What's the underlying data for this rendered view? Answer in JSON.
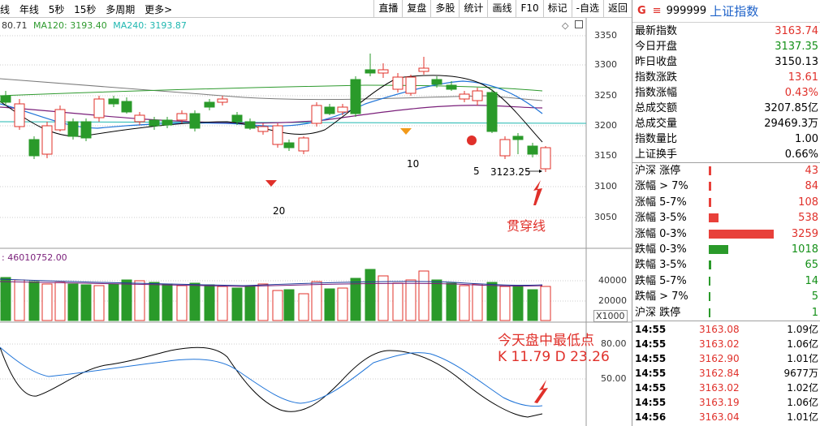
{
  "toolbar": {
    "left_items": [
      "线",
      "年线",
      "5秒",
      "15秒",
      "多周期",
      "更多>"
    ],
    "right_items": [
      "直播",
      "复盘",
      "多股",
      "统计",
      "画线",
      "F10",
      "标记",
      "-自选",
      "返回"
    ]
  },
  "main_chart": {
    "ma_line": {
      "ma_prefix": "80.71",
      "ma120": "MA120: 3193.40",
      "ma240": "MA240: 3193.87"
    },
    "y_ticks": [
      "3350",
      "3300",
      "3250",
      "3200",
      "3150",
      "3100",
      "3050"
    ],
    "marker_labels": [
      "20",
      "10",
      "5"
    ],
    "low_price_label": "3123.25",
    "annotation": "贯穿线"
  },
  "volume_chart": {
    "header": ": 46010752.00",
    "y_ticks": [
      "40000",
      "20000"
    ],
    "unit": "X1000"
  },
  "kdj_chart": {
    "y_ticks": [
      "80.00",
      "50.00"
    ],
    "annotation_line1": "今天盘中最低点",
    "annotation_line2": "K 11.79  D 23.26"
  },
  "right_panel": {
    "g_label": "G",
    "menu_icon": "≡",
    "code": "999999",
    "name": "上证指数",
    "quote": [
      {
        "label": "最新指数",
        "value": "3163.74",
        "color": "red"
      },
      {
        "label": "今日开盘",
        "value": "3137.35",
        "color": "green"
      },
      {
        "label": "昨日收盘",
        "value": "3150.13",
        "color": "black"
      },
      {
        "label": "指数涨跌",
        "value": "13.61",
        "color": "red"
      },
      {
        "label": "指数涨幅",
        "value": "0.43%",
        "color": "red"
      },
      {
        "label": "总成交额",
        "value": "3207.85亿",
        "color": "black"
      },
      {
        "label": "总成交量",
        "value": "29469.3万",
        "color": "black"
      },
      {
        "label": "指数量比",
        "value": "1.00",
        "color": "black"
      },
      {
        "label": "上证换手",
        "value": "0.66%",
        "color": "black"
      }
    ],
    "breadth": [
      {
        "label": "沪深 涨停",
        "value": "43",
        "color": "red"
      },
      {
        "label": "涨幅 > 7%",
        "value": "84",
        "color": "red"
      },
      {
        "label": "涨幅 5-7%",
        "value": "108",
        "color": "red"
      },
      {
        "label": "涨幅 3-5%",
        "value": "538",
        "color": "red"
      },
      {
        "label": "涨幅 0-3%",
        "value": "3259",
        "color": "red"
      },
      {
        "label": "跌幅 0-3%",
        "value": "1018",
        "color": "green"
      },
      {
        "label": "跌幅 3-5%",
        "value": "65",
        "color": "green"
      },
      {
        "label": "跌幅 5-7%",
        "value": "14",
        "color": "green"
      },
      {
        "label": "跌幅 > 7%",
        "value": "5",
        "color": "green"
      },
      {
        "label": "沪深 跌停",
        "value": "1",
        "color": "green"
      }
    ],
    "ticks": [
      {
        "time": "14:55",
        "price": "3163.08",
        "amount": "1.09亿"
      },
      {
        "time": "14:55",
        "price": "3163.02",
        "amount": "1.06亿"
      },
      {
        "time": "14:55",
        "price": "3162.90",
        "amount": "1.01亿"
      },
      {
        "time": "14:55",
        "price": "3162.84",
        "amount": "9677万"
      },
      {
        "time": "14:55",
        "price": "3163.02",
        "amount": "1.02亿"
      },
      {
        "time": "14:55",
        "price": "3163.19",
        "amount": "1.06亿"
      },
      {
        "time": "14:56",
        "price": "3163.04",
        "amount": "1.01亿"
      }
    ]
  }
}
